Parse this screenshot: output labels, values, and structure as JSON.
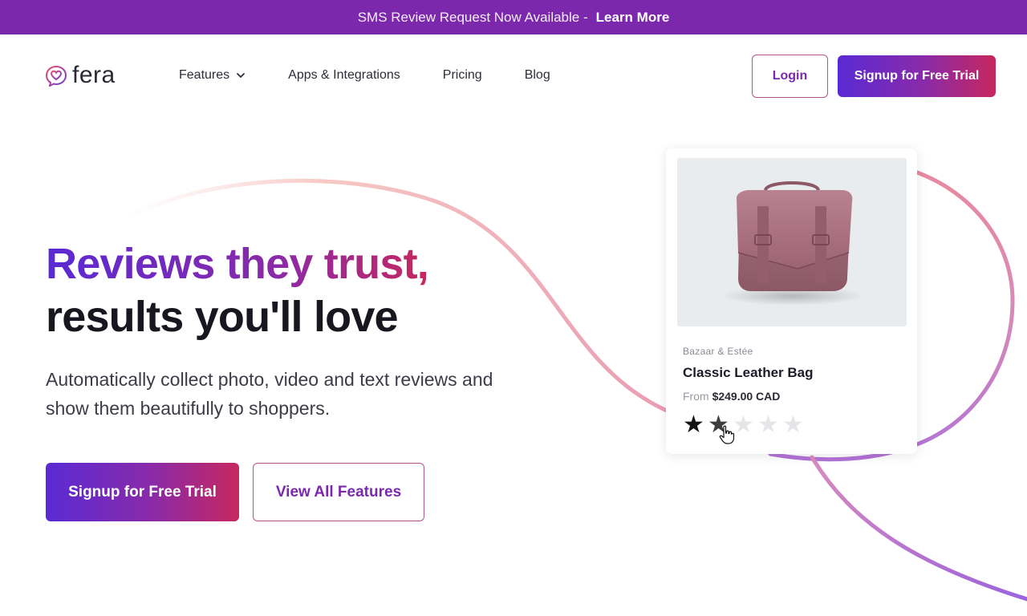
{
  "announcement": {
    "text": "SMS Review Request Now Available -",
    "link": "Learn More",
    "background": "#7b28ad"
  },
  "nav": {
    "logo_text": "fera",
    "items": [
      {
        "label": "Features",
        "has_dropdown": true
      },
      {
        "label": "Apps & Integrations"
      },
      {
        "label": "Pricing"
      },
      {
        "label": "Blog"
      }
    ],
    "login": "Login",
    "signup": "Signup for Free Trial"
  },
  "hero": {
    "title_highlight": "Reviews they trust,",
    "title_rest": "results you'll love",
    "subtitle": "Automatically collect photo, video and text reviews and show them beautifully to shoppers.",
    "primary_cta": "Signup for Free Trial",
    "secondary_cta": "View All Features"
  },
  "product_card": {
    "brand": "Bazaar & Estée",
    "name": "Classic Leather Bag",
    "price_prefix": "From",
    "price": "$249.00 CAD",
    "rating": 2,
    "rating_max": 5
  },
  "colors": {
    "brand_purple": "#7b28ad",
    "gradient_start": "#5a2ad4",
    "gradient_end": "#c7275f"
  },
  "icons": {
    "logo": "heart-chat-icon",
    "dropdown": "chevron-down-icon",
    "star": "star-icon",
    "cursor": "hand-pointer-icon"
  }
}
